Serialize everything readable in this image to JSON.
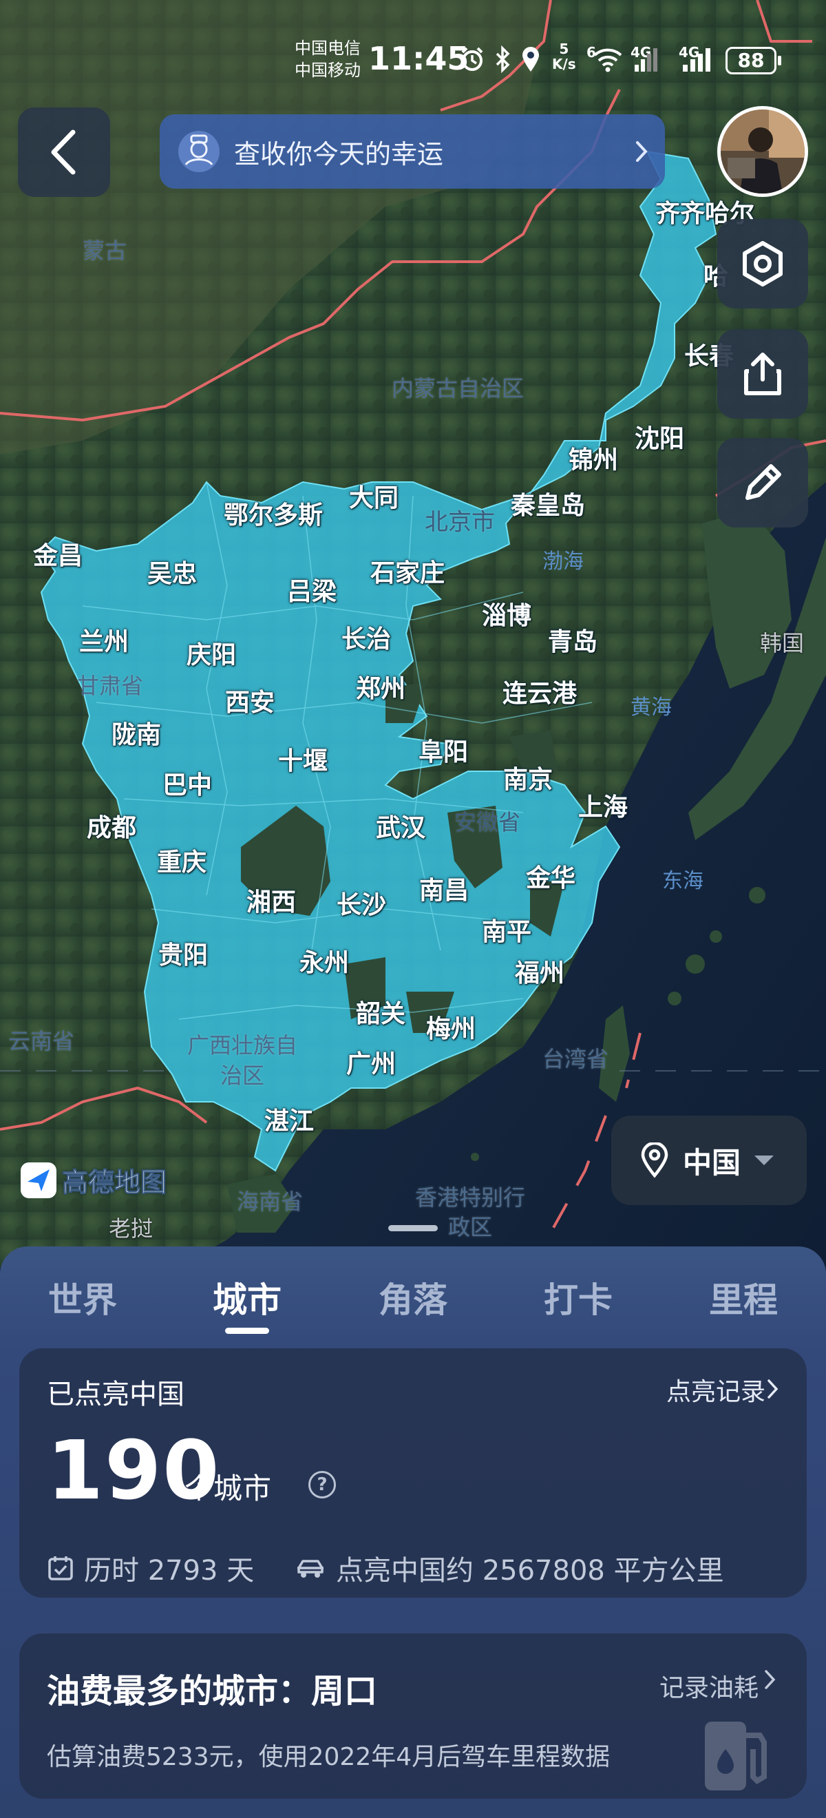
{
  "status_bar": {
    "carrier_1": "中国电信",
    "carrier_2": "中国移动",
    "time": "11:45",
    "net_speed_value": "5",
    "net_speed_unit": "K/s",
    "network_1": "6",
    "network_2": "4G",
    "network_3": "4G",
    "battery": "88"
  },
  "top_bar": {
    "fortune_text": "查收你今天的幸运"
  },
  "map": {
    "provider": "高德地图",
    "cities": [
      "齐齐哈尔",
      "哈",
      "长春",
      "沈阳",
      "锦州",
      "秦皇岛",
      "大同",
      "鄂尔多斯",
      "北京市",
      "金昌",
      "吴忠",
      "吕梁",
      "石家庄",
      "淄博",
      "兰州",
      "庆阳",
      "长治",
      "青岛",
      "西安",
      "郑州",
      "连云港",
      "陇南",
      "十堰",
      "阜阳",
      "巴中",
      "南京",
      "上海",
      "成都",
      "武汉",
      "安徽省",
      "重庆",
      "湘西",
      "长沙",
      "南昌",
      "金华",
      "贵阳",
      "永州",
      "南平",
      "福州",
      "韶关",
      "梅州",
      "广州",
      "湛江"
    ],
    "regions": [
      "蒙古",
      "内蒙古自治区",
      "甘肃省",
      "渤海",
      "韩国",
      "黄海",
      "东海",
      "云南省",
      "广西壮族自",
      "治区",
      "台湾省",
      "海南省",
      "香港特别行",
      "政区",
      "老挝"
    ],
    "region_selector": "中国"
  },
  "tabs": [
    "世界",
    "城市",
    "角落",
    "打卡",
    "里程"
  ],
  "active_tab": "城市",
  "lit_card": {
    "title": "已点亮中国",
    "record_link": "点亮记录",
    "count": "190",
    "unit": "个城市",
    "help": "?",
    "days_text": "历时 2793 天",
    "area_text": "点亮中国约 2567808 平方公里"
  },
  "fuel_card": {
    "title": "油费最多的城市：周口",
    "link": "记录油耗",
    "desc": "估算油费5233元，使用2022年4月后驾车里程数据"
  },
  "colors": {
    "lit_area": "#38bcd8",
    "sheet_bg": "#33497a",
    "fortune_bg": "#3b60aa",
    "border_red": "#e06868"
  }
}
